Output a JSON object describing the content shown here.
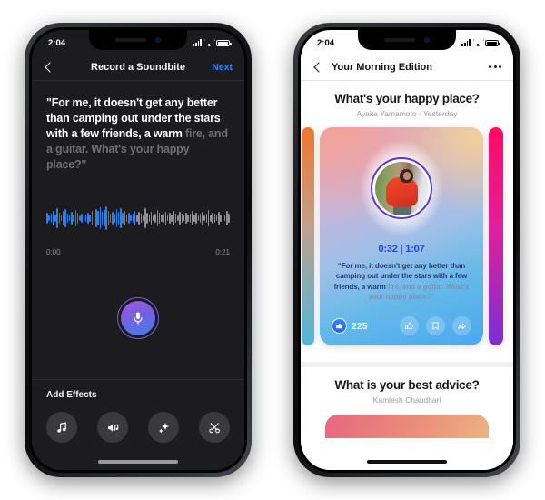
{
  "left_phone": {
    "status": {
      "time": "2:04",
      "signal_icon": "cellular-signal-icon",
      "wifi_icon": "wifi-icon",
      "battery_icon": "battery-icon"
    },
    "nav": {
      "back_icon": "back-chevron-icon",
      "title": "Record a Soundbite",
      "next_label": "Next"
    },
    "transcript": {
      "spoken": "\"For me, it doesn't get any better than camping out under the stars with a few friends, a warm ",
      "pending": "fire, and a guitar. What's your happy place?\""
    },
    "waveform": {
      "played_color": "#2f7fe0",
      "pending_color": "#8e8e93",
      "played_bars": 44,
      "heights": [
        22,
        10,
        18,
        30,
        14,
        44,
        24,
        10,
        30,
        38,
        20,
        10,
        26,
        16,
        34,
        22,
        12,
        18,
        10,
        14,
        22,
        16,
        30,
        24,
        40,
        30,
        46,
        26,
        36,
        50,
        30,
        20,
        26,
        18,
        38,
        28,
        42,
        22,
        32,
        16,
        24,
        12,
        20,
        30,
        14,
        26,
        18,
        10,
        44,
        22,
        16,
        28,
        12,
        20,
        34,
        24,
        14,
        18,
        26,
        10,
        22,
        16,
        30,
        20,
        12,
        26,
        18,
        10,
        24,
        14,
        20,
        30,
        16,
        22,
        12,
        18,
        26,
        10,
        20,
        34,
        14,
        24,
        18,
        10,
        28,
        16,
        22,
        12,
        30,
        18
      ],
      "start_time": "0:00",
      "end_time": "0:21"
    },
    "record": {
      "mic_icon": "microphone-icon"
    },
    "effects": {
      "label": "Add Effects",
      "items": [
        {
          "name": "music-note-icon",
          "glyph": "music"
        },
        {
          "name": "sound-effect-icon",
          "glyph": "soundfx"
        },
        {
          "name": "sparkles-icon",
          "glyph": "sparkles"
        },
        {
          "name": "scissors-icon",
          "glyph": "scissors"
        }
      ]
    }
  },
  "right_phone": {
    "status": {
      "time": "2:04",
      "signal_icon": "cellular-signal-icon",
      "wifi_icon": "wifi-icon",
      "battery_icon": "battery-icon"
    },
    "nav": {
      "back_icon": "back-chevron-icon",
      "title": "Your Morning Edition",
      "more_icon": "more-options-icon"
    },
    "section_one": {
      "question": "What's your happy place?",
      "byline": "Ayaka Yamamoto · Yesterday"
    },
    "card": {
      "avatar_alt": "person in red hoodie",
      "time": "0:32 | 1:07",
      "caption_spoken": "“For me, it doesn't get any better than camping out under the stars with a few friends, a warm ",
      "caption_pending": "fire, and a guitar. What's your happy place?”",
      "like_count": "225",
      "like_badge_icon": "thumbs-up-filled-icon",
      "actions": [
        {
          "name": "thumbs-up-icon"
        },
        {
          "name": "bookmark-icon"
        },
        {
          "name": "share-icon"
        }
      ]
    },
    "section_two": {
      "question": "What is your best advice?",
      "byline": "Kamlesh Chaudhari"
    }
  }
}
